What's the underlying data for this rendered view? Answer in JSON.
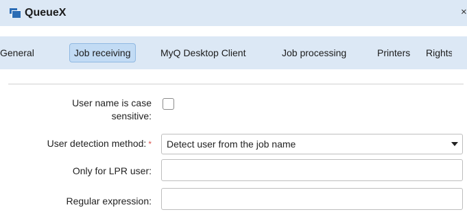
{
  "window": {
    "title": "QueueX",
    "close_glyph": "×",
    "title_icon": "queue-icon"
  },
  "tabs": [
    {
      "label": "General",
      "active": false
    },
    {
      "label": "Job receiving",
      "active": true
    },
    {
      "label": "MyQ Desktop Client",
      "active": false
    },
    {
      "label": "Job processing",
      "active": false
    },
    {
      "label": "Printers",
      "active": false
    },
    {
      "label": "Rights",
      "active": false
    }
  ],
  "form": {
    "case_sensitive": {
      "label_line1": "User name is case",
      "label_line2": "sensitive:",
      "checked": false
    },
    "detection_method": {
      "label": "User detection method:",
      "required_mark": "*",
      "value": "Detect user from the job name"
    },
    "lpr_user": {
      "label": "Only for LPR user:",
      "value": "",
      "placeholder": ""
    },
    "regex": {
      "label": "Regular expression:",
      "value": "",
      "placeholder": ""
    }
  },
  "colors": {
    "header_bg": "#dce8f5",
    "active_tab_bg": "#c2dbf4",
    "icon_blue": "#2a6cb5",
    "required_red": "#d9534f"
  }
}
